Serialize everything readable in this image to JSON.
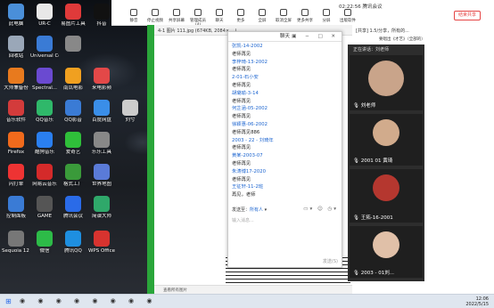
{
  "desktop_icons": [
    {
      "label": "此电脑",
      "color": "#4a8fd9"
    },
    {
      "label": "UR-C",
      "color": "#e8e8e8"
    },
    {
      "label": "易图片工具",
      "color": "#e03a3a"
    },
    {
      "label": "抖音",
      "color": "#111111"
    },
    {
      "label": "回收站",
      "color": "#9aa7b8"
    },
    {
      "label": "Universal Control",
      "color": "#3a7bd5"
    },
    {
      "label": "",
      "color": "#888888"
    },
    {
      "label": "大师兼备份",
      "color": "#e87a1e"
    },
    {
      "label": "Spectral...",
      "color": "#6a4ad1"
    },
    {
      "label": "南瓜电影",
      "color": "#f0a020"
    },
    {
      "label": "来电影频",
      "color": "#e34848"
    },
    {
      "label": "音乐软件",
      "color": "#d33b3b"
    },
    {
      "label": "QQ音乐",
      "color": "#2fb86a"
    },
    {
      "label": "QQ影音",
      "color": "#3a7bd5"
    },
    {
      "label": "百度网盘",
      "color": "#3a8ee8"
    },
    {
      "label": "刘兮",
      "color": "#cccccc"
    },
    {
      "label": "Firefox",
      "color": "#f06a1c"
    },
    {
      "label": "酷狗音乐",
      "color": "#2a7ff0"
    },
    {
      "label": "爱奇艺",
      "color": "#2fbf3a"
    },
    {
      "label": "乐乐工具",
      "color": "#888888"
    },
    {
      "label": "闪打单",
      "color": "#e33"
    },
    {
      "label": "网易云音乐",
      "color": "#d42a2a"
    },
    {
      "label": "格式工厂",
      "color": "#3a9a3a"
    },
    {
      "label": "世界地图",
      "color": "#5a7bd8"
    },
    {
      "label": "控制面板",
      "color": "#3a7bd5"
    },
    {
      "label": "GAME",
      "color": "#555555"
    },
    {
      "label": "腾讯会议",
      "color": "#2a6be8"
    },
    {
      "label": "简谱大师",
      "color": "#2fa86a"
    },
    {
      "label": "Sequoia 12 (64-Bit)",
      "color": "#777777"
    },
    {
      "label": "微信",
      "color": "#2dbb48"
    },
    {
      "label": "腾讯QQ",
      "color": "#1e8fe0"
    },
    {
      "label": "WPS Office",
      "color": "#d8332f"
    }
  ],
  "meeting": {
    "time": "02:22:56",
    "name": "腾讯会议",
    "toolbar": [
      "静音",
      "停止视频",
      "共享屏幕",
      "管理成员(4)",
      "聊天",
      "更多",
      "全屏",
      "取消全屏",
      "更多共享",
      "分屏",
      "出版软件"
    ],
    "end_label": "结束共享"
  },
  "viewer": {
    "title": "4-1 图片 111.jpg (674KB, 2084×... )",
    "footer": "查看所有图片"
  },
  "chat": {
    "title": "聊天",
    "messages": [
      {
        "type": "n",
        "text": "张凯-14-2002"
      },
      {
        "type": "t",
        "text": "老师再见"
      },
      {
        "type": "n",
        "text": "李梓琦-13-2002"
      },
      {
        "type": "t",
        "text": "老师再见"
      },
      {
        "type": "n",
        "text": "2-01-石小安"
      },
      {
        "type": "t",
        "text": "老师再见"
      },
      {
        "type": "n",
        "text": "胡璐瑜-3-14"
      },
      {
        "type": "t",
        "text": "老师再见"
      },
      {
        "type": "n",
        "text": "何芷涵-05-2002"
      },
      {
        "type": "t",
        "text": "老师再见"
      },
      {
        "type": "n",
        "text": "徐颖惠-06-2002"
      },
      {
        "type": "t",
        "text": "老师再见886"
      },
      {
        "type": "n",
        "text": "2003 - 22 - 刘琦年"
      },
      {
        "type": "t",
        "text": "老师再见"
      },
      {
        "type": "n",
        "text": "黄某-2003-07"
      },
      {
        "type": "t",
        "text": "老师再见"
      },
      {
        "type": "n",
        "text": "朱涛博17-2020"
      },
      {
        "type": "t",
        "text": "老师再见"
      },
      {
        "type": "n",
        "text": "王征轩-11-2班"
      },
      {
        "type": "t",
        "text": "再见，老师"
      }
    ],
    "send_to_label": "发送至：",
    "send_to_target": "所有人",
    "placeholder": "输入消息...",
    "send_label": "发送(S)"
  },
  "right_panel": {
    "top": "[共享] 1.5/分享，所有的...",
    "sub": "要唱出《才艺》（全部的）",
    "header": "正在讲话：刘老师"
  },
  "participants": [
    {
      "name": "刘老师",
      "face": "#c9a48a"
    },
    {
      "name": "2001 01 黄琦",
      "face": "#d1ab8c"
    },
    {
      "name": "王拓-16-2001",
      "face": "#b5372f"
    },
    {
      "name": "2003 - 01刘...",
      "face": "#e0c0a8"
    }
  ],
  "tray": {
    "time": "12:06",
    "date": "2022/5/15"
  }
}
